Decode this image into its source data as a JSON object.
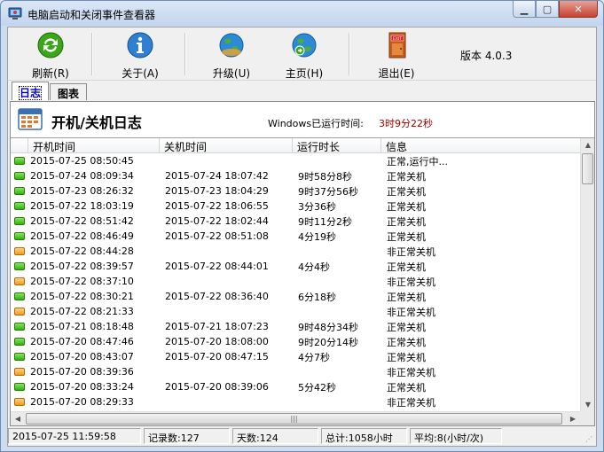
{
  "window": {
    "title": "电脑启动和关闭事件查看器"
  },
  "toolbar": {
    "refresh": "刷新(R)",
    "about": "关于(A)",
    "upgrade": "升级(U)",
    "homepage": "主页(H)",
    "exit": "退出(E)",
    "version": "版本 4.0.3"
  },
  "tabs": [
    {
      "label": "日志"
    },
    {
      "label": "图表"
    }
  ],
  "panel": {
    "title": "开机/关机日志",
    "runtime_label": "Windows已运行时间:",
    "runtime_value": "3时9分22秒"
  },
  "columns": [
    "开机时间",
    "关机时间",
    "运行时长",
    "信息"
  ],
  "rows": [
    {
      "status": "ok",
      "start": "2015-07-25 08:50:45",
      "end": "",
      "duration": "",
      "info": "正常,运行中..."
    },
    {
      "status": "ok",
      "start": "2015-07-24 08:09:34",
      "end": "2015-07-24 18:07:42",
      "duration": "9时58分8秒",
      "info": "正常关机"
    },
    {
      "status": "ok",
      "start": "2015-07-23 08:26:32",
      "end": "2015-07-23 18:04:29",
      "duration": "9时37分56秒",
      "info": "正常关机"
    },
    {
      "status": "ok",
      "start": "2015-07-22 18:03:19",
      "end": "2015-07-22 18:06:55",
      "duration": "3分36秒",
      "info": "正常关机"
    },
    {
      "status": "ok",
      "start": "2015-07-22 08:51:42",
      "end": "2015-07-22 18:02:44",
      "duration": "9时11分2秒",
      "info": "正常关机"
    },
    {
      "status": "ok",
      "start": "2015-07-22 08:46:49",
      "end": "2015-07-22 08:51:08",
      "duration": "4分19秒",
      "info": "正常关机"
    },
    {
      "status": "warn",
      "start": "2015-07-22 08:44:28",
      "end": "",
      "duration": "",
      "info": "非正常关机"
    },
    {
      "status": "ok",
      "start": "2015-07-22 08:39:57",
      "end": "2015-07-22 08:44:01",
      "duration": "4分4秒",
      "info": "正常关机"
    },
    {
      "status": "warn",
      "start": "2015-07-22 08:37:10",
      "end": "",
      "duration": "",
      "info": "非正常关机"
    },
    {
      "status": "ok",
      "start": "2015-07-22 08:30:21",
      "end": "2015-07-22 08:36:40",
      "duration": "6分18秒",
      "info": "正常关机"
    },
    {
      "status": "warn",
      "start": "2015-07-22 08:21:33",
      "end": "",
      "duration": "",
      "info": "非正常关机"
    },
    {
      "status": "ok",
      "start": "2015-07-21 08:18:48",
      "end": "2015-07-21 18:07:23",
      "duration": "9时48分34秒",
      "info": "正常关机"
    },
    {
      "status": "ok",
      "start": "2015-07-20 08:47:46",
      "end": "2015-07-20 18:08:00",
      "duration": "9时20分14秒",
      "info": "正常关机"
    },
    {
      "status": "ok",
      "start": "2015-07-20 08:43:07",
      "end": "2015-07-20 08:47:15",
      "duration": "4分7秒",
      "info": "正常关机"
    },
    {
      "status": "warn",
      "start": "2015-07-20 08:39:36",
      "end": "",
      "duration": "",
      "info": "非正常关机"
    },
    {
      "status": "ok",
      "start": "2015-07-20 08:33:24",
      "end": "2015-07-20 08:39:06",
      "duration": "5分42秒",
      "info": "正常关机"
    },
    {
      "status": "warn",
      "start": "2015-07-20 08:29:33",
      "end": "",
      "duration": "",
      "info": "非正常关机"
    }
  ],
  "statusbar": {
    "datetime": "2015-07-25 11:59:58",
    "records": "记录数:127",
    "days": "天数:124",
    "total": "总计:1058小时",
    "average": "平均:8(小时/次)"
  },
  "colors": {
    "ok": "#27b70b",
    "warn": "#f19a1a",
    "runtime": "#a00000"
  }
}
